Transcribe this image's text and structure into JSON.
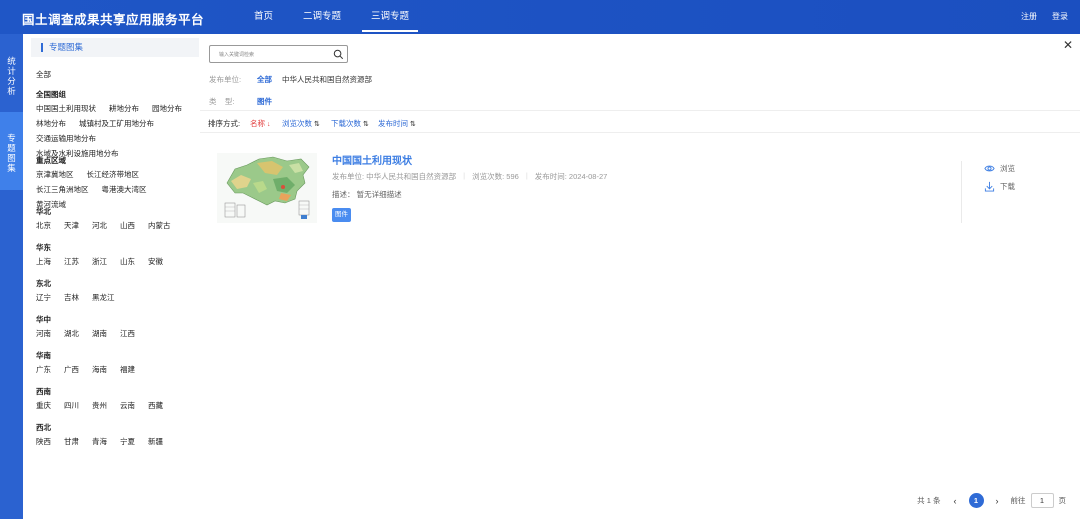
{
  "app": {
    "title": "国土调查成果共享应用服务平台"
  },
  "nav": [
    {
      "label": "首页"
    },
    {
      "label": "二调专题"
    },
    {
      "label": "三调专题"
    }
  ],
  "auth": {
    "register": "注册",
    "login": "登录"
  },
  "rail": {
    "tab1": "统计分析",
    "tab2": "专题图集"
  },
  "sidebar": {
    "title": "专题图集",
    "all": "全部",
    "groups": [
      {
        "title": "全国图组",
        "items": [
          "中国国土利用现状",
          "耕地分布",
          "园地分布",
          "林地分布",
          "城镇村及工矿用地分布",
          "交通运输用地分布",
          "水域及水利设施用地分布"
        ]
      },
      {
        "title": "重点区域",
        "items": [
          "京津冀地区",
          "长江经济带地区",
          "长江三角洲地区",
          "粤港澳大湾区",
          "黄河流域"
        ]
      },
      {
        "title": "华北",
        "items": [
          "北京",
          "天津",
          "河北",
          "山西",
          "内蒙古"
        ]
      },
      {
        "title": "华东",
        "items": [
          "上海",
          "江苏",
          "浙江",
          "山东",
          "安徽"
        ]
      },
      {
        "title": "东北",
        "items": [
          "辽宁",
          "吉林",
          "黑龙江"
        ]
      },
      {
        "title": "华中",
        "items": [
          "河南",
          "湖北",
          "湖南",
          "江西"
        ]
      },
      {
        "title": "华南",
        "items": [
          "广东",
          "广西",
          "海南",
          "福建"
        ]
      },
      {
        "title": "西南",
        "items": [
          "重庆",
          "四川",
          "贵州",
          "云南",
          "西藏"
        ]
      },
      {
        "title": "西北",
        "items": [
          "陕西",
          "甘肃",
          "青海",
          "宁夏",
          "新疆"
        ]
      }
    ]
  },
  "search": {
    "placeholder": "输入关键词检索"
  },
  "filters": {
    "publisher_label": "发布单位:",
    "publisher_options": [
      "全部",
      "中华人民共和国自然资源部"
    ],
    "type_label": "类    型:",
    "type_options": [
      "图件"
    ]
  },
  "sort": {
    "label": "排序方式:",
    "name": "名称",
    "name_arrow": "↓",
    "views": "浏览次数",
    "downloads": "下载次数",
    "time": "发布时间",
    "dbl_arrow": "⇅"
  },
  "card": {
    "title": "中国国土利用现状",
    "publisher": "发布单位: 中华人民共和国自然资源部",
    "views": "浏览次数: 596",
    "time": "发布时间: 2024-08-27",
    "desc": "描述： 暂无详细描述",
    "tag": "图件",
    "action_view": "浏览",
    "action_download": "下载"
  },
  "pager": {
    "total": "共 1 条",
    "current": "1",
    "goto_label": "前往",
    "goto_value": "1",
    "page_unit": "页"
  },
  "colors": {
    "header": "#1f56c6",
    "accent": "#2f6bd6",
    "sort_active": "#e23a3a"
  }
}
